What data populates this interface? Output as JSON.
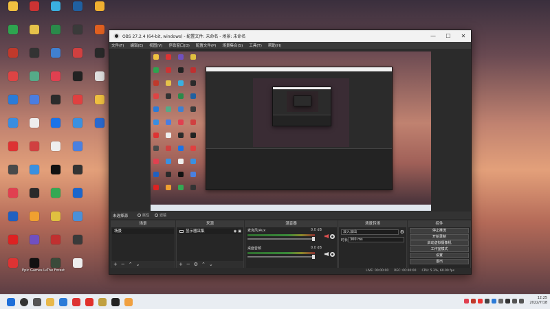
{
  "desktop": {
    "icons": [
      {
        "label": "",
        "color": "#f0c040"
      },
      {
        "label": "",
        "color": "#2ea44f"
      },
      {
        "label": "",
        "color": "#c0392b"
      },
      {
        "label": "",
        "color": "#d44"
      },
      {
        "label": "",
        "color": "#2b7bd8"
      },
      {
        "label": "",
        "color": "#3a8de0"
      },
      {
        "label": "",
        "color": "#d33"
      },
      {
        "label": "",
        "color": "#4a4a4a"
      },
      {
        "label": "",
        "color": "#e04050"
      },
      {
        "label": "",
        "color": "#2060c0"
      },
      {
        "label": "",
        "color": "#d22"
      },
      {
        "label": "",
        "color": "#dd3333"
      },
      {
        "label": "",
        "color": "#c33"
      },
      {
        "label": "",
        "color": "#e6c24a"
      },
      {
        "label": "",
        "color": "#333"
      },
      {
        "label": "",
        "color": "#5a8"
      },
      {
        "label": "",
        "color": "#4b7de0"
      },
      {
        "label": "",
        "color": "#eee"
      },
      {
        "label": "",
        "color": "#d04040"
      },
      {
        "label": "",
        "color": "#3a90e0"
      },
      {
        "label": "",
        "color": "#2a2a2a"
      },
      {
        "label": "",
        "color": "#f0a030"
      },
      {
        "label": "",
        "color": "#7050c0"
      },
      {
        "label": "",
        "color": "#222"
      },
      {
        "label": "",
        "color": "#3ab0e0"
      },
      {
        "label": "",
        "color": "#2a8a4a"
      },
      {
        "label": "",
        "color": "#4080d0"
      },
      {
        "label": "",
        "color": "#e04050"
      },
      {
        "label": "",
        "color": "#2b2b2b"
      },
      {
        "label": "",
        "color": "#1a73e8"
      },
      {
        "label": "",
        "color": "#eee"
      },
      {
        "label": "",
        "color": "#111"
      },
      {
        "label": "",
        "color": "#34a853"
      },
      {
        "label": "",
        "color": "#e0c040"
      },
      {
        "label": "",
        "color": "#c03030"
      },
      {
        "label": "",
        "color": "#2a2a2a"
      },
      {
        "label": "",
        "color": "#2060a0"
      },
      {
        "label": "",
        "color": "#3a3a3a"
      },
      {
        "label": "",
        "color": "#d04040"
      },
      {
        "label": "",
        "color": "#222"
      },
      {
        "label": "",
        "color": "#e04040"
      },
      {
        "label": "",
        "color": "#3a90e0"
      },
      {
        "label": "",
        "color": "#4a80e0"
      },
      {
        "label": "",
        "color": "#333"
      },
      {
        "label": "",
        "color": "#1a66cc"
      },
      {
        "label": "",
        "color": "#4a90d9"
      },
      {
        "label": "",
        "color": "#3a3a3a"
      },
      {
        "label": "",
        "color": "#eee"
      },
      {
        "label": "",
        "color": "#f0b030"
      },
      {
        "label": "",
        "color": "#e06020"
      },
      {
        "label": "",
        "color": "#2a2a2a"
      },
      {
        "label": "",
        "color": "#e0e0e0"
      },
      {
        "label": "",
        "color": "#f0c040"
      },
      {
        "label": "",
        "color": "#2a6ad0"
      },
      {
        "label": "Epic Games Launcher",
        "color": "#111"
      },
      {
        "label": "The Forest",
        "color": "#3a4a3a"
      }
    ]
  },
  "obs": {
    "title": "OBS 27.2.4 (64-bit, windows) - 配置文件: 未命名 - 场景: 未命名",
    "menu": [
      "文件(F)",
      "编辑(E)",
      "视图(V)",
      "停靠窗口(D)",
      "配置文件(P)",
      "场景集合(S)",
      "工具(T)",
      "帮助(H)"
    ],
    "scene_bar": {
      "label": "未选择源",
      "properties": "属性",
      "filters": "滤镜"
    },
    "docks": {
      "scenes": {
        "header": "场景",
        "item": "场景"
      },
      "sources": {
        "header": "来源",
        "item": "显示器采集"
      },
      "mixer": {
        "header": "混音器",
        "rows": [
          {
            "name": "麦克风/Aux",
            "db": "0.0 dB"
          },
          {
            "name": "桌面音频",
            "db": "0.0 dB"
          }
        ]
      },
      "transitions": {
        "header": "场景转场",
        "type": "淡入淡出",
        "duration_label": "时长",
        "duration": "300 ms"
      },
      "controls": {
        "header": "控件",
        "buttons": [
          "停止推流",
          "开始录制",
          "启动虚拟摄像机",
          "工作室模式",
          "设置",
          "退出"
        ]
      }
    },
    "status": [
      "LIVE: 00:00:00",
      "REC: 00:00:00",
      "CPU: 5.3%, 60.00 fps"
    ],
    "window_buttons": {
      "minimize": "—",
      "maximize": "☐",
      "close": "✕"
    }
  },
  "taskbar": {
    "time": "12:25",
    "date": "2022/7/18"
  }
}
